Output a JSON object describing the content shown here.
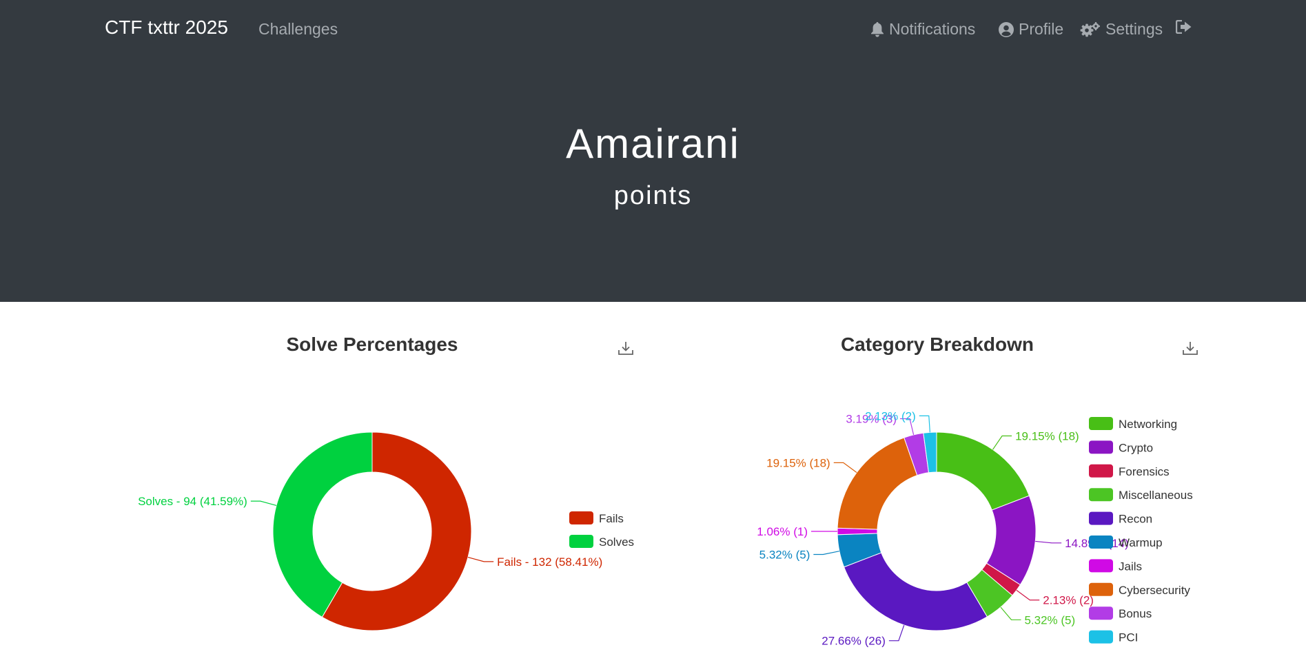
{
  "navbar": {
    "brand": "CTF txttr 2025",
    "challenges": "Challenges",
    "notifications": "Notifications",
    "profile": "Profile",
    "settings": "Settings",
    "icons": [
      "bell-icon",
      "user-circle-icon",
      "cogs-icon",
      "sign-out-icon"
    ]
  },
  "hero": {
    "name": "Amairani",
    "points": "points"
  },
  "colors": {
    "navbar_bg": "#343a40",
    "fails": "#cf2600",
    "solves": "#00d13f"
  },
  "chart_data": [
    {
      "type": "pie",
      "title": "Solve Percentages",
      "categories": [
        "Fails",
        "Solves"
      ],
      "values": [
        132,
        94
      ],
      "labels": [
        "Fails - 132 (58.41%)",
        "Solves - 94 (41.59%)"
      ],
      "colors": [
        "#cf2600",
        "#00d13f"
      ],
      "legend": "right"
    },
    {
      "type": "pie",
      "title": "Category Breakdown",
      "categories": [
        "Networking",
        "Crypto",
        "Forensics",
        "Miscellaneous",
        "Recon",
        "Warmup",
        "Jails",
        "Cybersecurity",
        "Bonus",
        "PCI"
      ],
      "values": [
        18,
        14,
        2,
        5,
        26,
        5,
        1,
        18,
        3,
        2
      ],
      "labels": [
        "19.15% (18)",
        "14.89% (14)",
        "2.13% (2)",
        "5.32% (5)",
        "27.66% (26)",
        "5.32% (5)",
        "1.06% (1)",
        "19.15% (18)",
        "3.19% (3)",
        "2.13% (2)"
      ],
      "colors": [
        "#48bf16",
        "#8b15c3",
        "#d01748",
        "#4cc524",
        "#5a18c1",
        "#0a84c1",
        "#d00ae5",
        "#dd620b",
        "#b23ce6",
        "#1cc1e6"
      ],
      "legend": "right"
    }
  ]
}
